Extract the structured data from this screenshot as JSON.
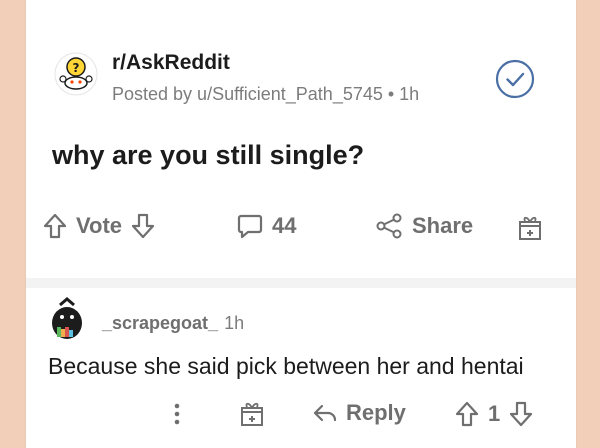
{
  "post": {
    "subreddit": "r/AskReddit",
    "meta": "Posted by u/Sufficient_Path_5745 • 1h",
    "title": "why are you still single?",
    "actions": {
      "vote_label": "Vote",
      "comments_count": "44",
      "share_label": "Share"
    }
  },
  "comment": {
    "username": "_scrapegoat_",
    "time": "1h",
    "body": "Because she said pick between her and hentai",
    "actions": {
      "reply_label": "Reply",
      "vote_count": "1"
    }
  },
  "colors": {
    "page_background": "#f1cfb8",
    "card": "#ffffff",
    "text_primary": "#1c1c1c",
    "text_muted": "#7c7c7c",
    "icon": "#6f6f6f",
    "join_accent": "#4a6fa5"
  },
  "icons": [
    "subreddit-avatar-icon",
    "joined-check-icon",
    "upvote-arrow-icon",
    "downvote-arrow-icon",
    "comment-bubble-icon",
    "share-icon",
    "award-gift-icon",
    "more-dots-icon",
    "reply-arrow-icon"
  ]
}
